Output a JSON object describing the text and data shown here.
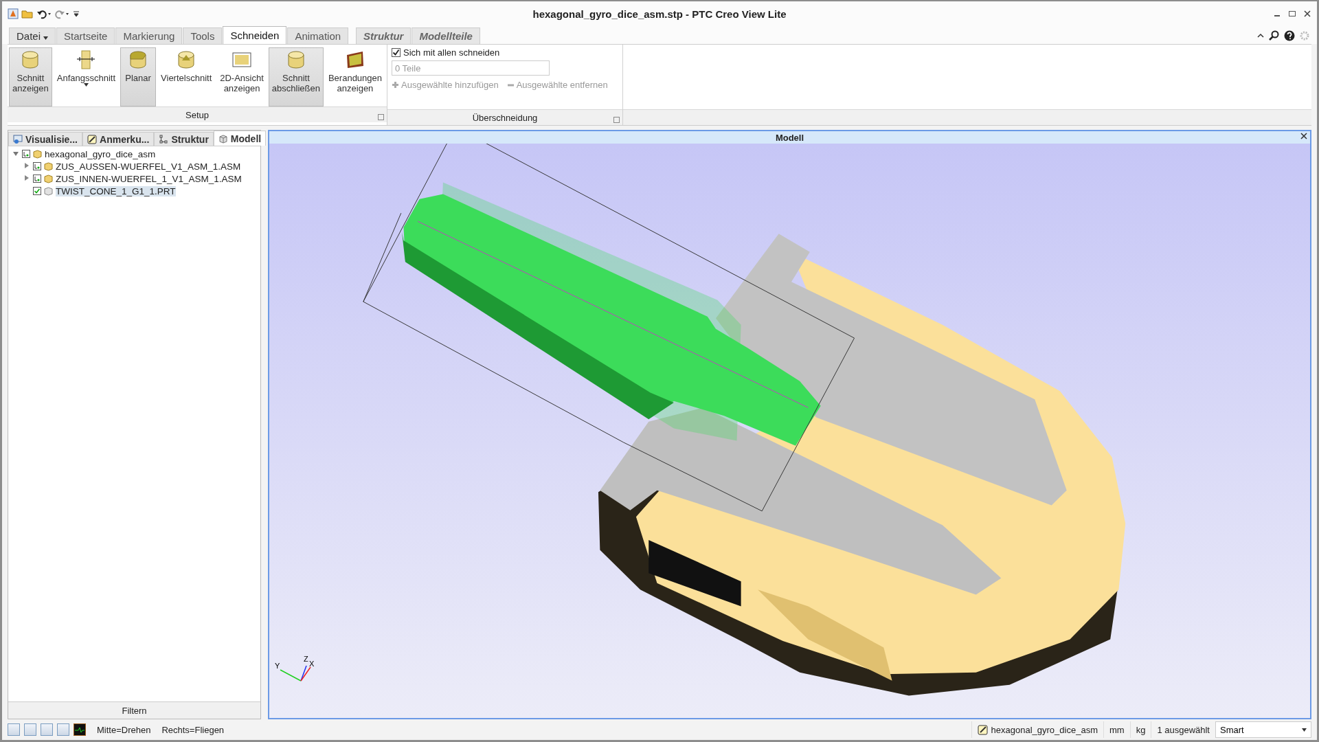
{
  "window": {
    "title": "hexagonal_gyro_dice_asm.stp - PTC Creo View Lite"
  },
  "tabs": [
    {
      "label": "Datei",
      "kind": "file",
      "selected": false
    },
    {
      "label": "Startseite",
      "kind": "normal",
      "selected": false
    },
    {
      "label": "Markierung",
      "kind": "normal",
      "selected": false
    },
    {
      "label": "Tools",
      "kind": "normal",
      "selected": false
    },
    {
      "label": "Schneiden",
      "kind": "normal",
      "selected": true
    },
    {
      "label": "Animation",
      "kind": "normal",
      "selected": false
    },
    {
      "label": "Struktur",
      "kind": "contextual",
      "selected": false
    },
    {
      "label": "Modellteile",
      "kind": "contextual",
      "selected": false
    }
  ],
  "ribbon": {
    "setup": {
      "label": "Setup",
      "buttons": [
        {
          "label": "Schnitt\nanzeigen",
          "selected": true,
          "dropdown": false
        },
        {
          "label": "Anfangsschnitt",
          "selected": false,
          "dropdown": true
        },
        {
          "label": "Planar",
          "selected": true,
          "dropdown": false
        },
        {
          "label": "Viertelschnitt",
          "selected": false,
          "dropdown": false
        },
        {
          "label": "2D-Ansicht\nanzeigen",
          "selected": false,
          "dropdown": false
        },
        {
          "label": "Schnitt\nabschließen",
          "selected": true,
          "dropdown": false
        },
        {
          "label": "Berandungen\nanzeigen",
          "selected": false,
          "dropdown": false
        }
      ]
    },
    "intersection": {
      "label": "Überschneidung",
      "checkbox": {
        "label": "Sich mit allen schneiden",
        "checked": true
      },
      "field": {
        "placeholder": "0 Teile"
      },
      "actions": [
        {
          "label": "Ausgewählte hinzufügen",
          "disabled": true
        },
        {
          "label": "Ausgewählte entfernen",
          "disabled": true
        }
      ]
    }
  },
  "left_panel": {
    "tabs": [
      {
        "label": "Visualisie...",
        "selected": false
      },
      {
        "label": "Anmerku...",
        "selected": false
      },
      {
        "label": "Struktur",
        "selected": false
      },
      {
        "label": "Modell",
        "selected": true
      }
    ],
    "tree": [
      {
        "label": "hexagonal_gyro_dice_asm",
        "partial": true,
        "expanded": true,
        "selected": false,
        "children": [
          {
            "label": "ZUS_AUSSEN-WUERFEL_V1_ASM_1.ASM",
            "partial": true,
            "expanded": false,
            "selected": false
          },
          {
            "label": "ZUS_INNEN-WUERFEL_1_V1_ASM_1.ASM",
            "partial": true,
            "expanded": false,
            "selected": false
          },
          {
            "label": "TWIST_CONE_1_G1_1.PRT",
            "partial": false,
            "selected": true
          }
        ]
      }
    ],
    "footer": "Filtern"
  },
  "viewport": {
    "title": "Modell",
    "axes": [
      "Y",
      "Z",
      "X"
    ]
  },
  "status_bar": {
    "hints": [
      "Mitte=Drehen",
      "Rechts=Fliegen"
    ],
    "model": "hexagonal_gyro_dice_asm",
    "units": [
      "mm",
      "kg"
    ],
    "selection": "1 ausgewählt",
    "mode": "Smart"
  }
}
